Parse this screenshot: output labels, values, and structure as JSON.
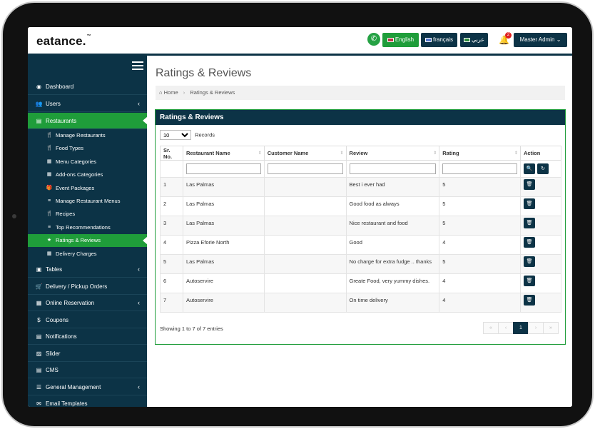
{
  "header": {
    "logo": "eatance.",
    "logo_tm": "™",
    "languages": [
      {
        "label": "English",
        "active": true
      },
      {
        "label": "français",
        "active": false
      },
      {
        "label": "عربي",
        "active": false
      }
    ],
    "notification_count": "2",
    "user_menu": "Master Admin"
  },
  "sidebar": {
    "items": [
      {
        "label": "Dashboard"
      },
      {
        "label": "Users"
      },
      {
        "label": "Restaurants"
      },
      {
        "label": "Tables"
      },
      {
        "label": "Delivery / Pickup Orders"
      },
      {
        "label": "Online Reservation"
      },
      {
        "label": "Coupons"
      },
      {
        "label": "Notifications"
      },
      {
        "label": "Slider"
      },
      {
        "label": "CMS"
      },
      {
        "label": "General Management"
      },
      {
        "label": "Email Templates"
      }
    ],
    "sub_items": [
      {
        "label": "Manage Restaurants"
      },
      {
        "label": "Food Types"
      },
      {
        "label": "Menu Categories"
      },
      {
        "label": "Add-ons Categories"
      },
      {
        "label": "Event Packages"
      },
      {
        "label": "Manage Restaurant Menus"
      },
      {
        "label": "Recipes"
      },
      {
        "label": "Top Recommendations"
      },
      {
        "label": "Ratings & Reviews"
      },
      {
        "label": "Delivery Charges"
      }
    ]
  },
  "page": {
    "title": "Ratings & Reviews",
    "breadcrumb": {
      "home": "Home",
      "current": "Ratings & Reviews"
    },
    "panel_title": "Ratings & Reviews",
    "records_value": "10",
    "records_label": "Records",
    "columns": [
      "Sr. No.",
      "Restaurant Name",
      "Customer Name",
      "Review",
      "Rating",
      "Action"
    ],
    "rows": [
      {
        "sr": "1",
        "restaurant": "Las Palmas",
        "customer": "",
        "review": "Best i ever had",
        "rating": "5"
      },
      {
        "sr": "2",
        "restaurant": "Las Palmas",
        "customer": "",
        "review": "Good food as always",
        "rating": "5"
      },
      {
        "sr": "3",
        "restaurant": "Las Palmas",
        "customer": "",
        "review": "Nice restaurant and food",
        "rating": "5"
      },
      {
        "sr": "4",
        "restaurant": "Pizza Eforie North",
        "customer": "",
        "review": "Good",
        "rating": "4"
      },
      {
        "sr": "5",
        "restaurant": "Las Palmas",
        "customer": "",
        "review": "No charge for extra fudge .. thanks",
        "rating": "5"
      },
      {
        "sr": "6",
        "restaurant": "Autoservire",
        "customer": "",
        "review": "Greate Food, very yummy dishes.",
        "rating": "4"
      },
      {
        "sr": "7",
        "restaurant": "Autoservire",
        "customer": "",
        "review": "On time delivery",
        "rating": "4"
      }
    ],
    "showing": "Showing 1 to 7 of 7 entries",
    "pagination": {
      "first": "«",
      "prev": "‹",
      "current": "1",
      "next": "›",
      "last": "»"
    }
  },
  "colors": {
    "navy": "#0c3346",
    "green": "#1f9d3a"
  }
}
